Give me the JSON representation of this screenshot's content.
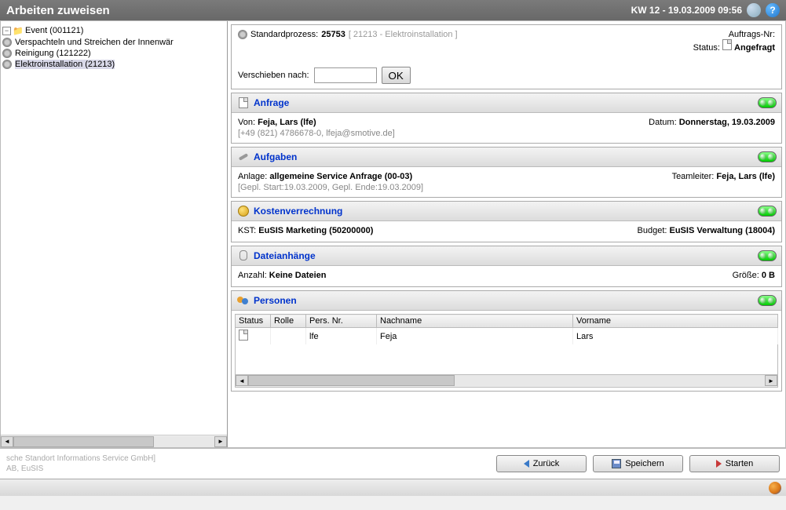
{
  "titlebar": {
    "title": "Arbeiten zuweisen",
    "datetime": "KW 12 - 19.03.2009 09:56"
  },
  "tree": {
    "root": "Event (001121)",
    "children": [
      {
        "label": "Verspachteln und Streichen der Innenwär"
      },
      {
        "label": "Reinigung (121222)"
      },
      {
        "label": "Elektroinstallation (21213)",
        "selected": true
      }
    ]
  },
  "process": {
    "label": "Standardprozess:",
    "id": "25753",
    "breadcrumb": "[ 21213 - Elektroinstallation ]",
    "auftrag_label": "Auftrags-Nr:",
    "status_label": "Status:",
    "status_value": "Angefragt",
    "shift_label": "Verschieben nach:",
    "ok": "OK"
  },
  "sections": {
    "anfrage": {
      "title": "Anfrage",
      "from_label": "Von:",
      "from_value": "Feja, Lars (lfe)",
      "date_label": "Datum:",
      "date_value": "Donnerstag, 19.03.2009",
      "contact": "[+49 (821) 4786678-0, lfeja@smotive.de]"
    },
    "aufgaben": {
      "title": "Aufgaben",
      "anlage_label": "Anlage:",
      "anlage_value": "allgemeine Service Anfrage (00-03)",
      "teamleiter_label": "Teamleiter:",
      "teamleiter_value": "Feja, Lars (lfe)",
      "plan": "[Gepl. Start:19.03.2009, Gepl. Ende:19.03.2009]"
    },
    "kosten": {
      "title": "Kostenverrechnung",
      "kst_label": "KST:",
      "kst_value": "EuSIS Marketing (50200000)",
      "budget_label": "Budget:",
      "budget_value": "EuSIS Verwaltung (18004)"
    },
    "dateien": {
      "title": "Dateianhänge",
      "count_label": "Anzahl:",
      "count_value": "Keine Dateien",
      "size_label": "Größe:",
      "size_value": "0 B"
    },
    "personen": {
      "title": "Personen",
      "cols": {
        "status": "Status",
        "rolle": "Rolle",
        "persnr": "Pers. Nr.",
        "nachname": "Nachname",
        "vorname": "Vorname"
      },
      "row": {
        "persnr": "lfe",
        "nachname": "Feja",
        "vorname": "Lars"
      }
    }
  },
  "footer": {
    "copy1": "sche Standort Informations Service GmbH]",
    "copy2": "AB, EuSIS",
    "back": "Zurück",
    "save": "Speichern",
    "start": "Starten"
  }
}
